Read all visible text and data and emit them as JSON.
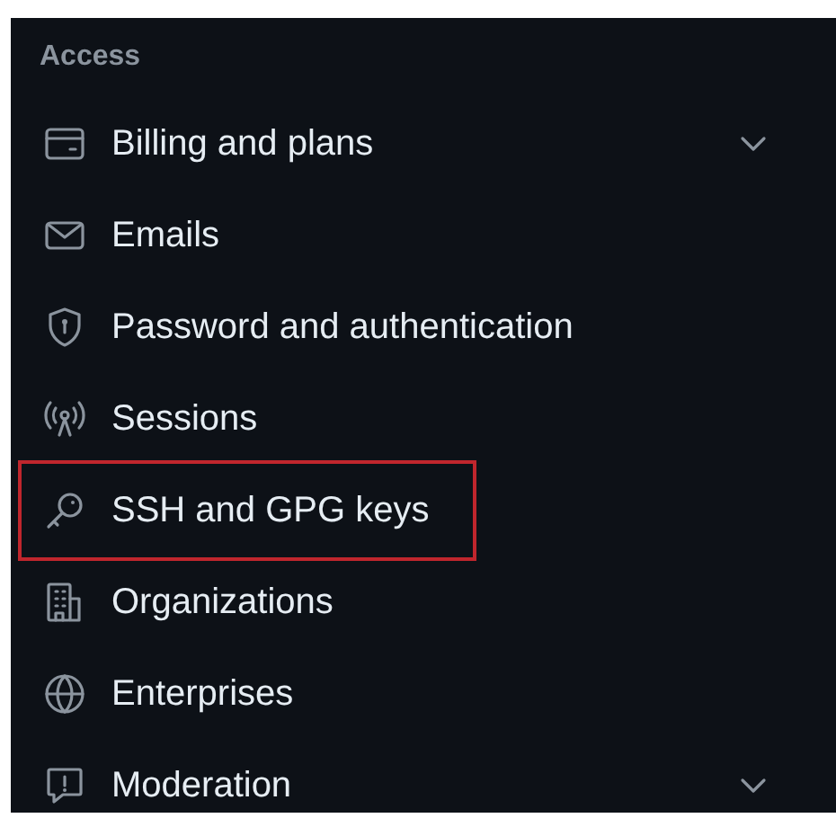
{
  "section_header": "Access",
  "items": [
    {
      "label": "Billing and plans",
      "expandable": true,
      "highlighted": false
    },
    {
      "label": "Emails",
      "expandable": false,
      "highlighted": false
    },
    {
      "label": "Password and authentication",
      "expandable": false,
      "highlighted": false
    },
    {
      "label": "Sessions",
      "expandable": false,
      "highlighted": false
    },
    {
      "label": "SSH and GPG keys",
      "expandable": false,
      "highlighted": true
    },
    {
      "label": "Organizations",
      "expandable": false,
      "highlighted": false
    },
    {
      "label": "Enterprises",
      "expandable": false,
      "highlighted": false
    },
    {
      "label": "Moderation",
      "expandable": true,
      "highlighted": false
    }
  ]
}
